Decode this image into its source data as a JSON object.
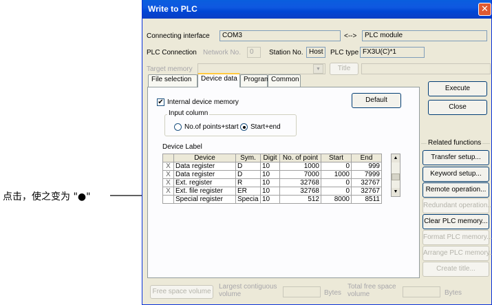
{
  "annotation": {
    "text": "点击，使之变为 \"●\""
  },
  "window": {
    "title": "Write to PLC",
    "close_glyph": "✕"
  },
  "connection": {
    "label": "Connecting interface",
    "value": "COM3",
    "arrow": "<-->",
    "target": "PLC module"
  },
  "plc_connection": {
    "label": "PLC Connection",
    "network_label": "Network No.",
    "network_value": "0",
    "station_label": "Station No.",
    "station_value": "Host",
    "type_label": "PLC type",
    "type_value": "FX3U(C)*1"
  },
  "target_memory": {
    "label": "Target memory",
    "title_button": "Title"
  },
  "tabs": [
    {
      "label": "File selection"
    },
    {
      "label": "Device data"
    },
    {
      "label": "Program"
    },
    {
      "label": "Common"
    }
  ],
  "device_data": {
    "internal_memory_label": "Internal device memory",
    "internal_memory_checked": "✔",
    "default_button": "Default",
    "input_column_label": "Input column",
    "option_points": "No.of points+start",
    "option_startend": "Start+end",
    "device_label": "Device Label",
    "columns": [
      "Device",
      "Sym.",
      "Digit",
      "No. of point",
      "Start",
      "End"
    ],
    "rows": [
      {
        "mark": "X",
        "device": "Data register",
        "sym": "D",
        "digit": "10",
        "points": "1000",
        "start": "0",
        "end": "999"
      },
      {
        "mark": "X",
        "device": "Data register",
        "sym": "D",
        "digit": "10",
        "points": "7000",
        "start": "1000",
        "end": "7999"
      },
      {
        "mark": "X",
        "device": "Ext. register",
        "sym": "R",
        "digit": "10",
        "points": "32768",
        "start": "0",
        "end": "32767"
      },
      {
        "mark": "X",
        "device": "Ext. file register",
        "sym": "ER",
        "digit": "10",
        "points": "32768",
        "start": "0",
        "end": "32767"
      },
      {
        "mark": "",
        "device": "Special register",
        "sym": "Specia",
        "digit": "10",
        "points": "512",
        "start": "8000",
        "end": "8511"
      }
    ]
  },
  "actions": {
    "execute": "Execute",
    "close": "Close"
  },
  "related": {
    "label": "Related functions",
    "buttons": [
      "Transfer setup...",
      "Keyword setup...",
      "Remote operation...",
      "Redundant operation...",
      "Clear PLC memory...",
      "Format PLC memory...",
      "Arrange PLC memory...",
      "Create title..."
    ]
  },
  "footer": {
    "free_space_button": "Free space volume",
    "largest_label_1": "Largest contiguous",
    "largest_label_2": "volume",
    "bytes_1": "Bytes",
    "total_label_1": "Total free space",
    "total_label_2": "volume",
    "bytes_2": "Bytes"
  }
}
